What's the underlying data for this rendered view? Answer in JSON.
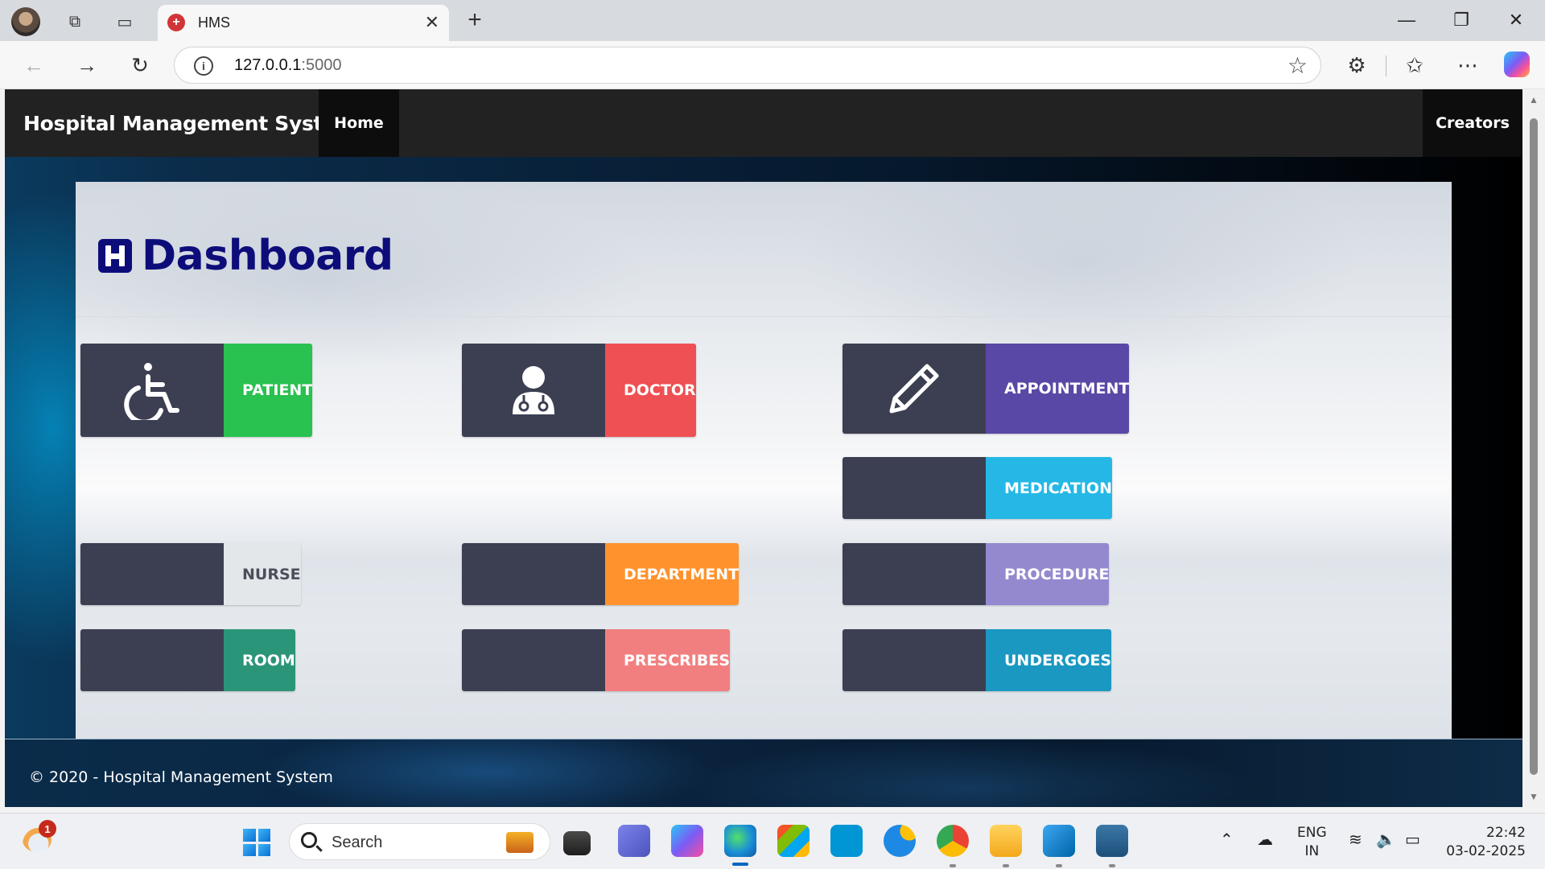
{
  "browser": {
    "tab": {
      "title": "HMS",
      "favicon": "red-cross-icon"
    },
    "address": {
      "host": "127.0.0.1",
      "port": ":5000"
    }
  },
  "site": {
    "brand": "Hospital Management System",
    "nav": {
      "home": "Home",
      "creators": "Creators"
    }
  },
  "dashboard": {
    "title": "Dashboard",
    "cards": [
      {
        "label": "PATIENT",
        "color": "#29c14f",
        "icon": "wheelchair-icon"
      },
      {
        "label": "DOCTOR",
        "color": "#ee5053",
        "icon": "doctor-icon"
      },
      {
        "label": "APPOINTMENT",
        "color": "#5a48a6",
        "icon": "pencil-icon"
      },
      {
        "label": "MEDICATION",
        "color": "#25b8e6"
      },
      {
        "label": "NURSE",
        "color": "#e3e7ea",
        "text_color": "#4a4f5a"
      },
      {
        "label": "DEPARTMENT",
        "color": "#ff922d"
      },
      {
        "label": "PROCEDURE",
        "color": "#9489cf"
      },
      {
        "label": "ROOM",
        "color": "#2b957a"
      },
      {
        "label": "PRESCRIBES",
        "color": "#f27f7f"
      },
      {
        "label": "UNDERGOES",
        "color": "#1a98c1"
      }
    ],
    "card_icon_bg": "#3c3f52"
  },
  "footer": {
    "text": "© 2020 - Hospital Management System"
  },
  "taskbar": {
    "notification_count": "1",
    "search_label": "Search",
    "language": {
      "line1": "ENG",
      "line2": "IN"
    },
    "clock": {
      "time": "22:42",
      "date": "03-02-2025"
    }
  }
}
